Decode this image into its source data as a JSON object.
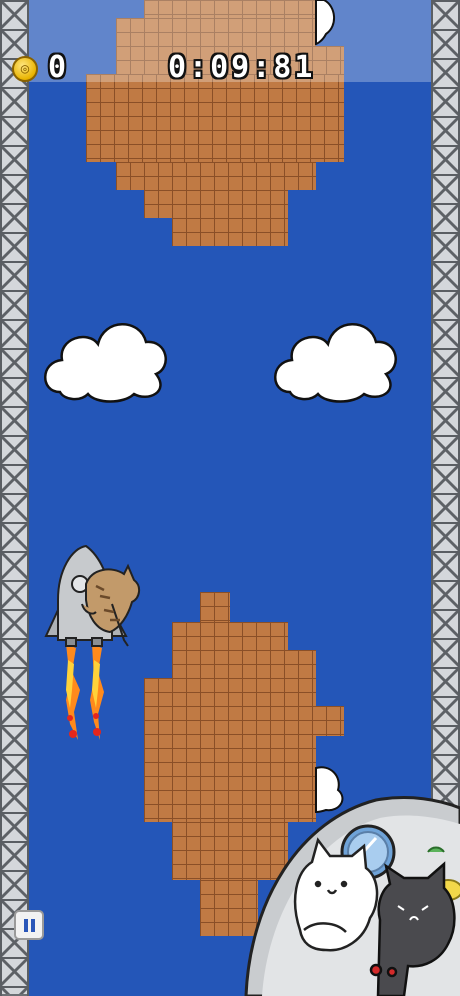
{
  "hud": {
    "coin_count": "0",
    "timer": "0:09:81",
    "coin_icon": "coin-icon"
  },
  "controls": {
    "pause_icon": "pause-icon"
  },
  "colors": {
    "sky": "#2456b8",
    "brick": "#c07a44",
    "mortar": "#8a4f27"
  }
}
